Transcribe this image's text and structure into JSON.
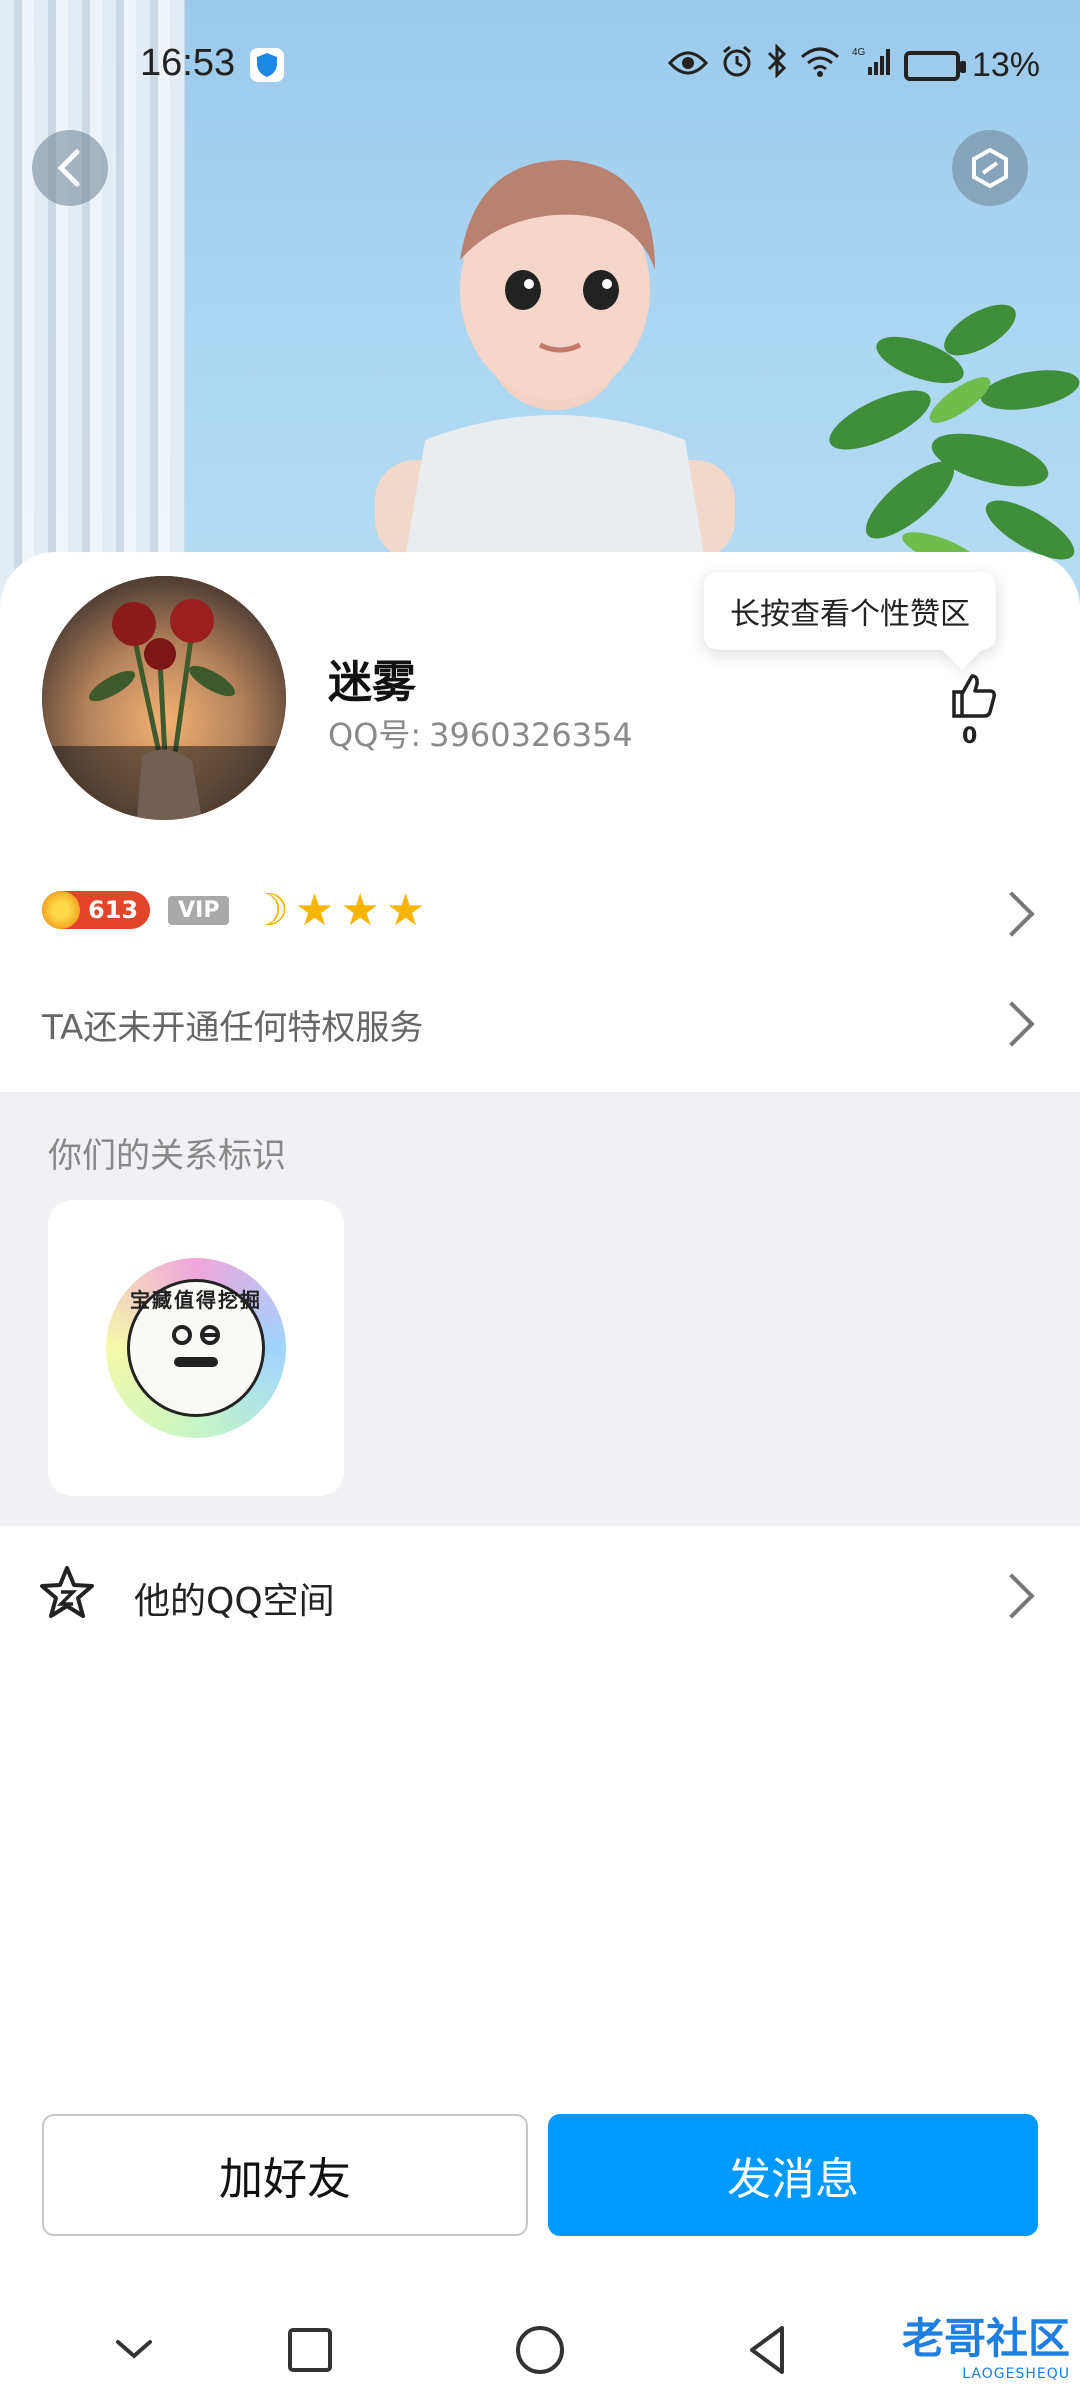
{
  "status_bar": {
    "time": "16:53",
    "battery_percent": "13%",
    "network": "4G"
  },
  "profile": {
    "name": "迷雾",
    "qq_label": "QQ号:",
    "qq_number": "3960326354",
    "like_tooltip": "长按查看个性赞区",
    "like_count": "0"
  },
  "badges": {
    "level": "613",
    "vip": "VIP",
    "stars": 3
  },
  "privilege": {
    "text": "TA还未开通任何特权服务"
  },
  "relation": {
    "title": "你们的关系标识",
    "emblem_text": "宝藏值得挖掘"
  },
  "qzone": {
    "label": "他的QQ空间"
  },
  "actions": {
    "add_friend": "加好友",
    "send_message": "发消息"
  },
  "watermark": {
    "main": "老哥社区",
    "sub": "LAOGESHEQU"
  },
  "colors": {
    "primary": "#0099ff",
    "level_badge": "#e3452b",
    "star": "#f7b500"
  }
}
